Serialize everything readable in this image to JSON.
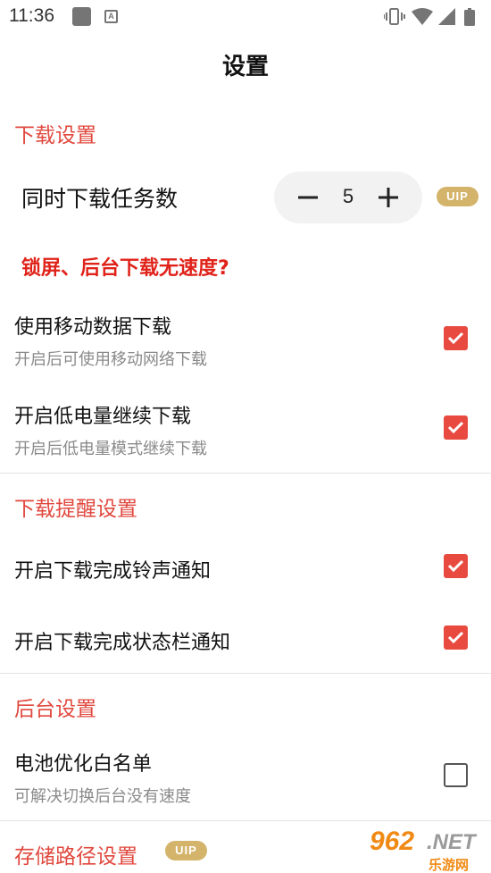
{
  "status_bar": {
    "time": "11:36",
    "icons": [
      "square-notification-icon",
      "a-notification-icon",
      "vibrate-icon",
      "wifi-icon",
      "signal-icon",
      "battery-icon"
    ]
  },
  "title": "设置",
  "colors": {
    "accent": "#e84a3f",
    "header_red": "#e0483e",
    "vip_gold": "#d4b46a",
    "sub_gray": "#8a8a8a"
  },
  "download": {
    "header": "下载设置",
    "task_label": "同时下载任务数",
    "task_value": "5",
    "vip": "UIP",
    "warning_link": "锁屏、后台下载无速度?",
    "mobile_data": {
      "label": "使用移动数据下载",
      "sub": "开启后可使用移动网络下载",
      "checked": true
    },
    "low_battery": {
      "label": "开启低电量继续下载",
      "sub": "开启后低电量模式继续下载",
      "checked": true
    }
  },
  "reminder": {
    "header": "下载提醒设置",
    "ringtone": {
      "label": "开启下载完成铃声通知",
      "checked": true
    },
    "statusbar": {
      "label": "开启下载完成状态栏通知",
      "checked": true
    }
  },
  "background": {
    "header": "后台设置",
    "battery_whitelist": {
      "label": "电池优化白名单",
      "sub": "可解决切换后台没有速度",
      "checked": false
    }
  },
  "storage": {
    "header": "存储路径设置",
    "vip": "UIP"
  },
  "watermark": {
    "number": "962",
    "domain": ".NET",
    "site": "乐游网"
  }
}
